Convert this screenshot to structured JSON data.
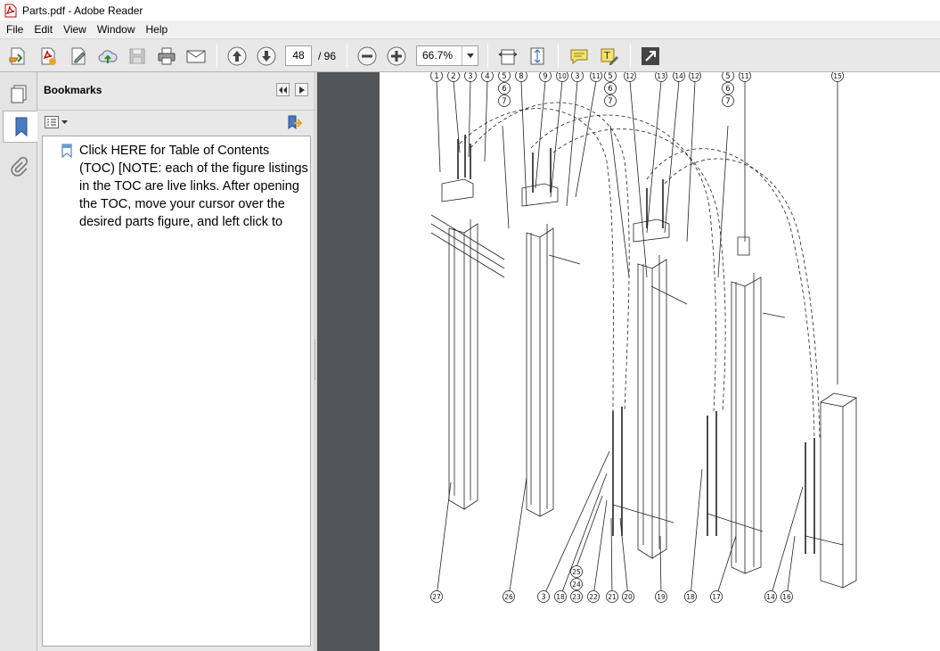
{
  "window": {
    "title": "Parts.pdf - Adobe Reader"
  },
  "menu": [
    "File",
    "Edit",
    "View",
    "Window",
    "Help"
  ],
  "toolbar": {
    "page_current": "48",
    "page_total": "/ 96",
    "zoom": "66.7%"
  },
  "bookmarks": {
    "title": "Bookmarks",
    "entries": [
      {
        "label": "Click HERE for Table of Contents (TOC) [NOTE: each of the figure listings in the TOC are live links. After opening the TOC, move your cursor over the desired parts figure, and left click to"
      }
    ]
  },
  "diagram": {
    "top_callouts": [
      "1",
      "2",
      "3",
      "4",
      "5",
      "6",
      "7",
      "8",
      "9",
      "10",
      "3",
      "11",
      "5",
      "6",
      "7",
      "12",
      "13",
      "14",
      "12",
      "5",
      "6",
      "7",
      "11",
      "15"
    ],
    "bottom_callouts": [
      "27",
      "26",
      "3",
      "18",
      "25",
      "24",
      "23",
      "22",
      "21",
      "20",
      "19",
      "18",
      "17",
      "14",
      "16"
    ]
  },
  "colors": {
    "doc_bg": "#525659",
    "toolbar_bg": "#e8e8e8",
    "panel_bg": "#e8e8e8"
  }
}
